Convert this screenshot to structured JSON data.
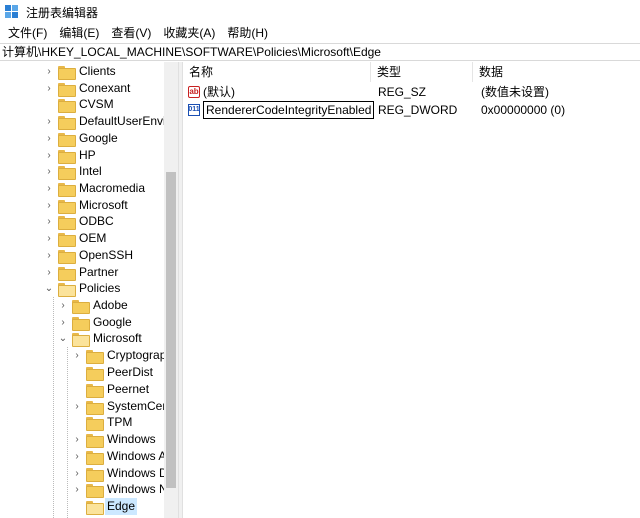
{
  "window": {
    "title": "注册表编辑器"
  },
  "menu": [
    {
      "label": "文件(F)"
    },
    {
      "label": "编辑(E)"
    },
    {
      "label": "查看(V)"
    },
    {
      "label": "收藏夹(A)"
    },
    {
      "label": "帮助(H)"
    }
  ],
  "address": {
    "path": "计算机\\HKEY_LOCAL_MACHINE\\SOFTWARE\\Policies\\Microsoft\\Edge"
  },
  "tree": {
    "items": [
      {
        "label": "Clients"
      },
      {
        "label": "Conexant"
      },
      {
        "label": "CVSM"
      },
      {
        "label": "DefaultUserEnviror"
      },
      {
        "label": "Google"
      },
      {
        "label": "HP"
      },
      {
        "label": "Intel"
      },
      {
        "label": "Macromedia"
      },
      {
        "label": "Microsoft"
      },
      {
        "label": "ODBC"
      },
      {
        "label": "OEM"
      },
      {
        "label": "OpenSSH"
      },
      {
        "label": "Partner"
      },
      {
        "label": "Policies"
      },
      {
        "label": "Adobe"
      },
      {
        "label": "Google"
      },
      {
        "label": "Microsoft"
      },
      {
        "label": "Cryptograph"
      },
      {
        "label": "PeerDist"
      },
      {
        "label": "Peernet"
      },
      {
        "label": "SystemCertifi"
      },
      {
        "label": "TPM"
      },
      {
        "label": "Windows"
      },
      {
        "label": "Windows Adv"
      },
      {
        "label": "Windows Def"
      },
      {
        "label": "Windows NT"
      },
      {
        "label": "Edge"
      }
    ]
  },
  "list": {
    "headers": {
      "name": "名称",
      "type": "类型",
      "data": "数据"
    },
    "rows": [
      {
        "icon": "string-value-icon",
        "name": "(默认)",
        "type": "REG_SZ",
        "data": "(数值未设置)"
      },
      {
        "icon": "dword-value-icon",
        "name": "RendererCodeIntegrityEnabled",
        "type": "REG_DWORD",
        "data": "0x00000000 (0)"
      }
    ]
  },
  "icons": {
    "app": "registry-editor-icon",
    "folder": "folder-icon",
    "expand": "chevron-right-icon",
    "collapse": "chevron-down-icon"
  },
  "colors": {
    "folder": "#f5cd5c",
    "selection": "#cce8ff",
    "sz_icon": "#c82020",
    "dword_icon": "#1a4fb3"
  }
}
